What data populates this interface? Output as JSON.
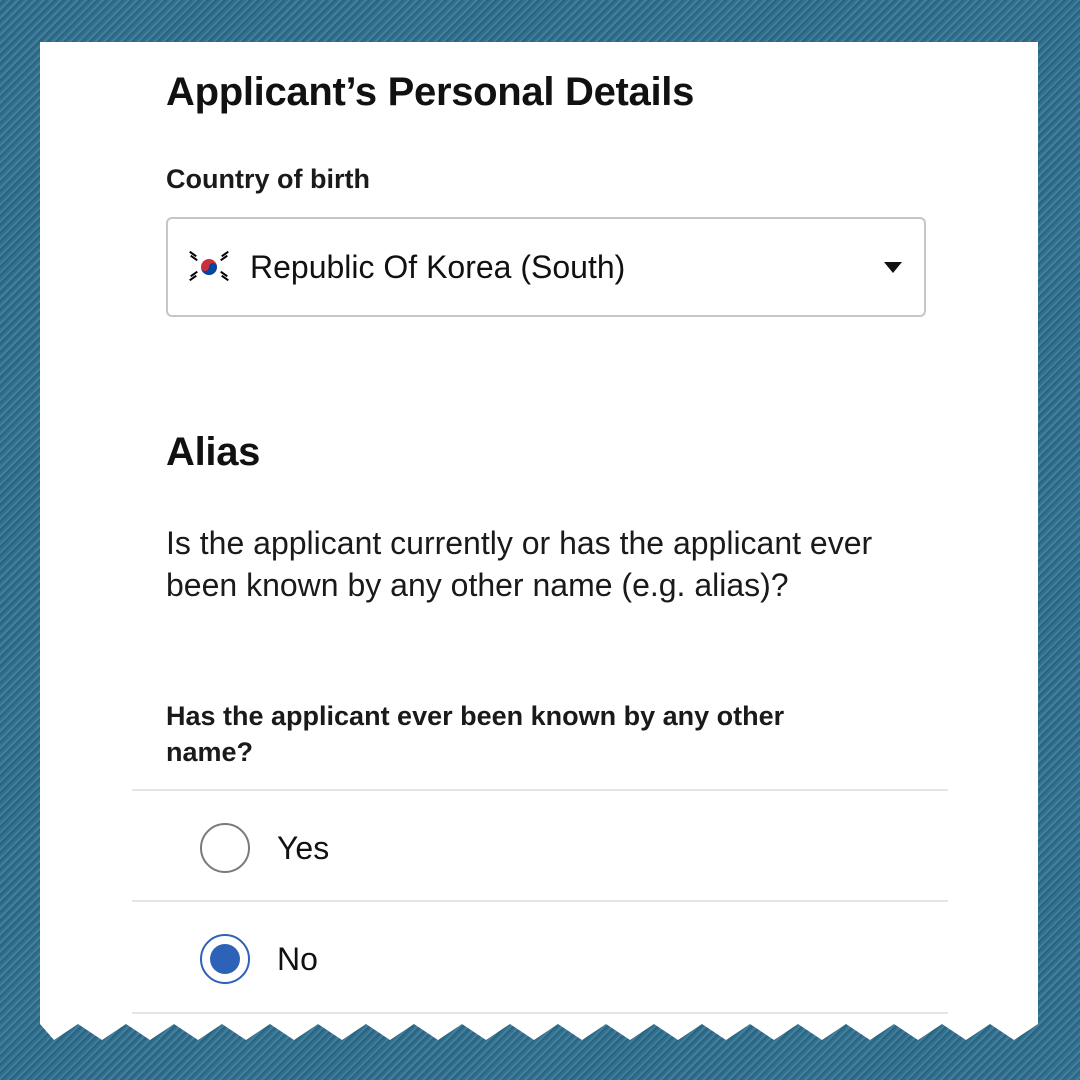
{
  "personal_details": {
    "title": "Applicant’s Personal Details",
    "country_label": "Country of birth",
    "country_value": "Republic Of Korea (South)",
    "country_flag_icon": "south-korea-flag-icon"
  },
  "alias": {
    "title": "Alias",
    "question": "Is the applicant currently or has the applicant ever been known by any other name (e.g. alias)?",
    "sub_question": "Has the applicant ever been known by any other name?",
    "options": [
      {
        "label": "Yes",
        "selected": false
      },
      {
        "label": "No",
        "selected": true
      }
    ]
  },
  "colors": {
    "background": "#2f6f8f",
    "accent": "#2c62b8"
  }
}
